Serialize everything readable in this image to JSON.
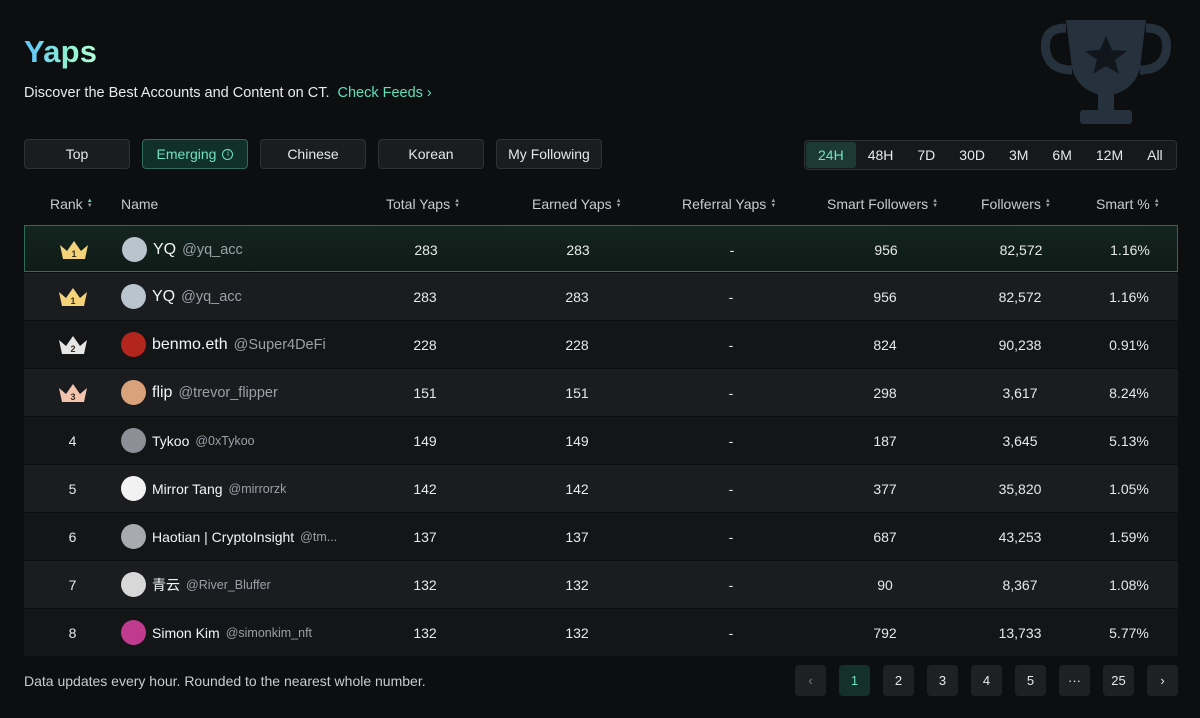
{
  "header": {
    "title": "Yaps",
    "subtitle": "Discover the Best Accounts and Content on CT.",
    "check_feeds": "Check Feeds",
    "chevron": "›"
  },
  "tabs": [
    {
      "label": "Top",
      "active": false
    },
    {
      "label": "Emerging",
      "active": true,
      "icon": "info-icon"
    },
    {
      "label": "Chinese",
      "active": false
    },
    {
      "label": "Korean",
      "active": false
    },
    {
      "label": "My Following",
      "active": false
    }
  ],
  "periods": [
    {
      "label": "24H",
      "active": true
    },
    {
      "label": "48H",
      "active": false
    },
    {
      "label": "7D",
      "active": false
    },
    {
      "label": "30D",
      "active": false
    },
    {
      "label": "3M",
      "active": false
    },
    {
      "label": "6M",
      "active": false
    },
    {
      "label": "12M",
      "active": false
    },
    {
      "label": "All",
      "active": false
    }
  ],
  "columns": {
    "rank": "Rank",
    "name": "Name",
    "total": "Total Yaps",
    "earned": "Earned Yaps",
    "referral": "Referral Yaps",
    "smart_followers": "Smart Followers",
    "followers": "Followers",
    "smart_pct": "Smart %"
  },
  "rows": [
    {
      "rank": "1",
      "crown": "gold",
      "name": "YQ",
      "handle": "@yq_acc",
      "total": "283",
      "earned": "283",
      "referral": "-",
      "smart_followers": "956",
      "followers": "82,572",
      "smart_pct": "1.16%",
      "highlight": true,
      "avatar_color": "#b9c4cf",
      "size": "big"
    },
    {
      "rank": "1",
      "crown": "gold",
      "name": "YQ",
      "handle": "@yq_acc",
      "total": "283",
      "earned": "283",
      "referral": "-",
      "smart_followers": "956",
      "followers": "82,572",
      "smart_pct": "1.16%",
      "highlight": false,
      "avatar_color": "#b9c4cf",
      "size": "big"
    },
    {
      "rank": "2",
      "crown": "silver",
      "name": "benmo.eth",
      "handle": "@Super4DeFi",
      "total": "228",
      "earned": "228",
      "referral": "-",
      "smart_followers": "824",
      "followers": "90,238",
      "smart_pct": "0.91%",
      "highlight": false,
      "avatar_color": "#b3261e",
      "size": "big"
    },
    {
      "rank": "3",
      "crown": "bronze",
      "name": "flip",
      "handle": "@trevor_flipper",
      "total": "151",
      "earned": "151",
      "referral": "-",
      "smart_followers": "298",
      "followers": "3,617",
      "smart_pct": "8.24%",
      "highlight": false,
      "avatar_color": "#d9a27a",
      "size": "big"
    },
    {
      "rank": "4",
      "crown": "",
      "name": "Tykoo",
      "handle": "@0xTykoo",
      "total": "149",
      "earned": "149",
      "referral": "-",
      "smart_followers": "187",
      "followers": "3,645",
      "smart_pct": "5.13%",
      "highlight": false,
      "avatar_color": "#8c9096",
      "size": "small"
    },
    {
      "rank": "5",
      "crown": "",
      "name": "Mirror Tang",
      "handle": "@mirrorzk",
      "total": "142",
      "earned": "142",
      "referral": "-",
      "smart_followers": "377",
      "followers": "35,820",
      "smart_pct": "1.05%",
      "highlight": false,
      "avatar_color": "#f2f2f2",
      "size": "small"
    },
    {
      "rank": "6",
      "crown": "",
      "name": "Haotian | CryptoInsight",
      "handle": "@tm...",
      "total": "137",
      "earned": "137",
      "referral": "-",
      "smart_followers": "687",
      "followers": "43,253",
      "smart_pct": "1.59%",
      "highlight": false,
      "avatar_color": "#a7abb0",
      "size": "small"
    },
    {
      "rank": "7",
      "crown": "",
      "name": "青云",
      "handle": "@River_Bluffer",
      "total": "132",
      "earned": "132",
      "referral": "-",
      "smart_followers": "90",
      "followers": "8,367",
      "smart_pct": "1.08%",
      "highlight": false,
      "avatar_color": "#d8d8d8",
      "size": "small"
    },
    {
      "rank": "8",
      "crown": "",
      "name": "Simon Kim",
      "handle": "@simonkim_nft",
      "total": "132",
      "earned": "132",
      "referral": "-",
      "smart_followers": "792",
      "followers": "13,733",
      "smart_pct": "5.77%",
      "highlight": false,
      "avatar_color": "#c03a8e",
      "size": "small"
    }
  ],
  "footer": {
    "note": "Data updates every hour. Rounded to the nearest whole number.",
    "pages": [
      "1",
      "2",
      "3",
      "4",
      "5",
      "···",
      "25"
    ],
    "current_page": "1",
    "prev": "‹",
    "next": "›"
  },
  "colors": {
    "accent": "#5fe0b8",
    "background": "#0d0e10",
    "gold": "#f3d27a",
    "silver": "#e6e6e6",
    "bronze": "#f2c3ad"
  },
  "icons": {
    "decor": "trophy-icon",
    "sort": "sort-icon",
    "crown": "crown-icon"
  }
}
